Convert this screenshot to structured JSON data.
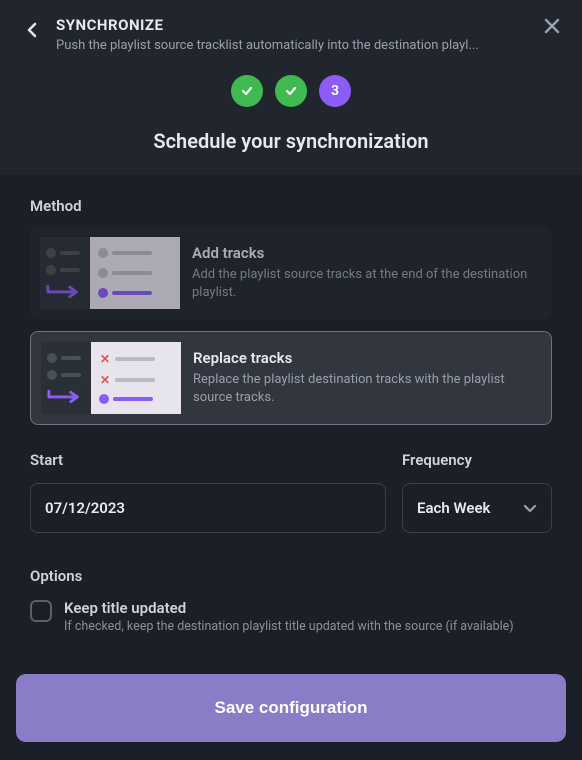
{
  "header": {
    "title": "SYNCHRONIZE",
    "subtitle": "Push the playlist source tracklist automatically into the destination playl..."
  },
  "steps": {
    "current": "3"
  },
  "schedule_title": "Schedule your synchronization",
  "method": {
    "label": "Method",
    "add": {
      "title": "Add tracks",
      "desc": "Add the playlist source tracks at the end of the destination playlist."
    },
    "replace": {
      "title": "Replace tracks",
      "desc": "Replace the playlist destination tracks with the playlist source tracks."
    }
  },
  "start": {
    "label": "Start",
    "value": "07/12/2023"
  },
  "frequency": {
    "label": "Frequency",
    "value": "Each Week"
  },
  "options": {
    "label": "Options",
    "keep_title": {
      "title": "Keep title updated",
      "desc": "If checked, keep the destination playlist title updated with the source (if available)"
    }
  },
  "save_label": "Save configuration"
}
